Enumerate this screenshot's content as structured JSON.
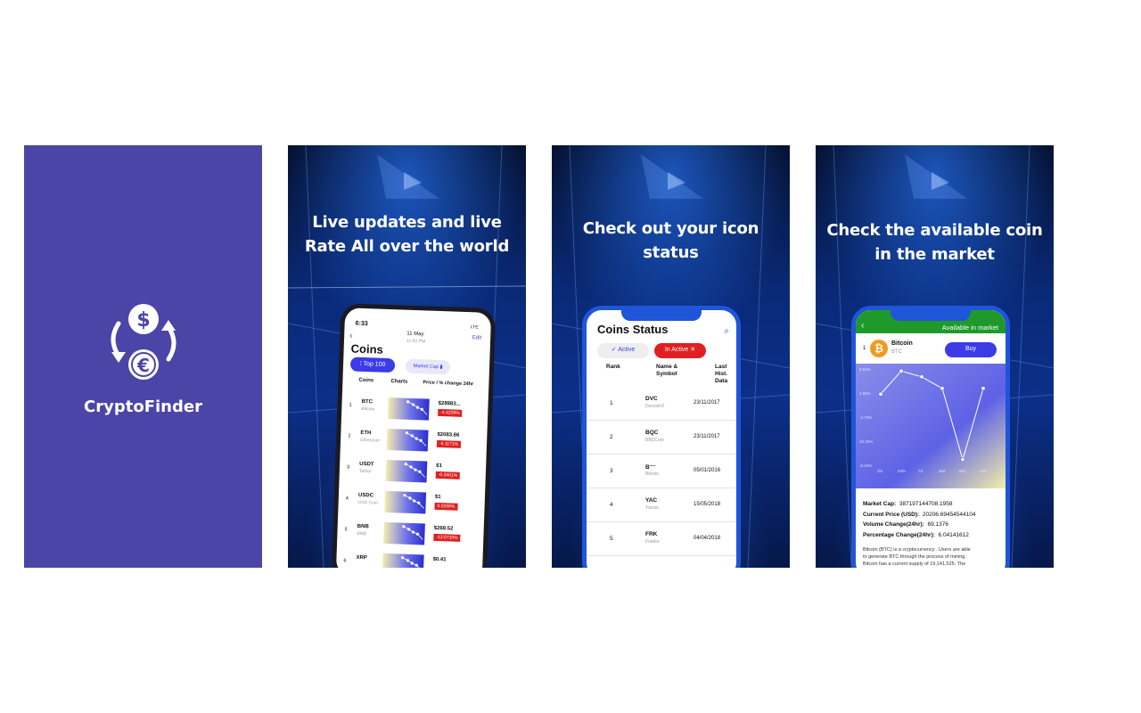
{
  "card1": {
    "app_name": "CryptoFinder",
    "icons": [
      "dollar-coin-icon",
      "euro-coin-icon",
      "exchange-arrows-icon"
    ]
  },
  "card2": {
    "headline_line1": "Live updates and live",
    "headline_line2": "Rate All over the world",
    "phone": {
      "time": "6:33",
      "status_right": "LTE",
      "date": "11 May",
      "date_sub": "11:02 PM",
      "edit_label": "Edit",
      "title": "Coins",
      "tab_top": "Top 100",
      "tab_market": "Market Cap",
      "col_coin": "Coins",
      "col_charts": "Charts",
      "col_price": "Price / % change 24hr",
      "rows": [
        {
          "rank": "1",
          "symbol": "BTC",
          "name": "Bitcoin",
          "price": "$28983...",
          "change": "-4.4239%"
        },
        {
          "rank": "2",
          "symbol": "ETH",
          "name": "Ethereum",
          "price": "$2083.66",
          "change": "-6.1171%"
        },
        {
          "rank": "3",
          "symbol": "USDT",
          "name": "Tether",
          "price": "$1",
          "change": "-0.3461%"
        },
        {
          "rank": "4",
          "symbol": "USDC",
          "name": "USD Coin",
          "price": "$1",
          "change": "0.0269%"
        },
        {
          "rank": "5",
          "symbol": "BNB",
          "name": "BNB",
          "price": "$269.52",
          "change": "-13.0739%"
        },
        {
          "rank": "6",
          "symbol": "XRP",
          "name": "",
          "price": "$0.41",
          "change": ""
        }
      ]
    }
  },
  "card3": {
    "headline_line1": "Check out your icon",
    "headline_line2": "status",
    "phone": {
      "title": "Coins Status",
      "filter_active": "Active",
      "filter_inactive": "In Active",
      "col_rank": "Rank",
      "col_name": "Name & Symbol",
      "col_date": "Last Hist. Data",
      "rows": [
        {
          "rank": "1",
          "symbol": "DVC",
          "name": "Devcoin3",
          "date": "23/11/2017"
        },
        {
          "rank": "2",
          "symbol": "BQC",
          "name": "BBQCoin",
          "date": "23/11/2017"
        },
        {
          "rank": "3",
          "symbol": "B⁻⁻",
          "name": "Bitcoin",
          "date": "05/01/2016"
        },
        {
          "rank": "4",
          "symbol": "YAC",
          "name": "Yacoin",
          "date": "15/05/2018"
        },
        {
          "rank": "5",
          "symbol": "FRK",
          "name": "Franko",
          "date": "04/04/2018"
        }
      ]
    }
  },
  "card4": {
    "headline_line1": "Check  the available coin",
    "headline_line2": "in  the market",
    "phone": {
      "header": "Available in market",
      "qty": "1",
      "coin_name": "Bitcoin",
      "coin_symbol": "BTC",
      "buy_label": "Buy",
      "chart_y_labels": [
        "6.04%",
        "4.85%",
        "-4.74%",
        "10.15%",
        "-0.22%"
      ],
      "chart_x_labels": [
        "1hr",
        "24hr",
        "7d",
        "30d",
        "60d",
        "90d"
      ],
      "chart_points": [
        0.72,
        0.96,
        0.9,
        0.78,
        0.04,
        0.78
      ],
      "market_cap_label": "Market Cap:",
      "market_cap": "387197144708.1958",
      "price_label": "Current Price (USD):",
      "price": "20206.69454544104",
      "volume_label": "Volume Change(24hr):",
      "volume": "69.1376",
      "pct_label": "Percentage Change(24hr):",
      "pct": "6.04141612",
      "desc_line1": "Bitcoin (BTC) is a cryptocurrency . Users are able",
      "desc_line2": "to generate BTC through the process of mining.",
      "desc_line3": "Bitcoin has a current supply of 19,141,525. The"
    }
  },
  "colors": {
    "brand": "#4b45a8",
    "accent": "#3b3be8",
    "negative": "#e02020",
    "market_green": "#1f9a2a"
  }
}
